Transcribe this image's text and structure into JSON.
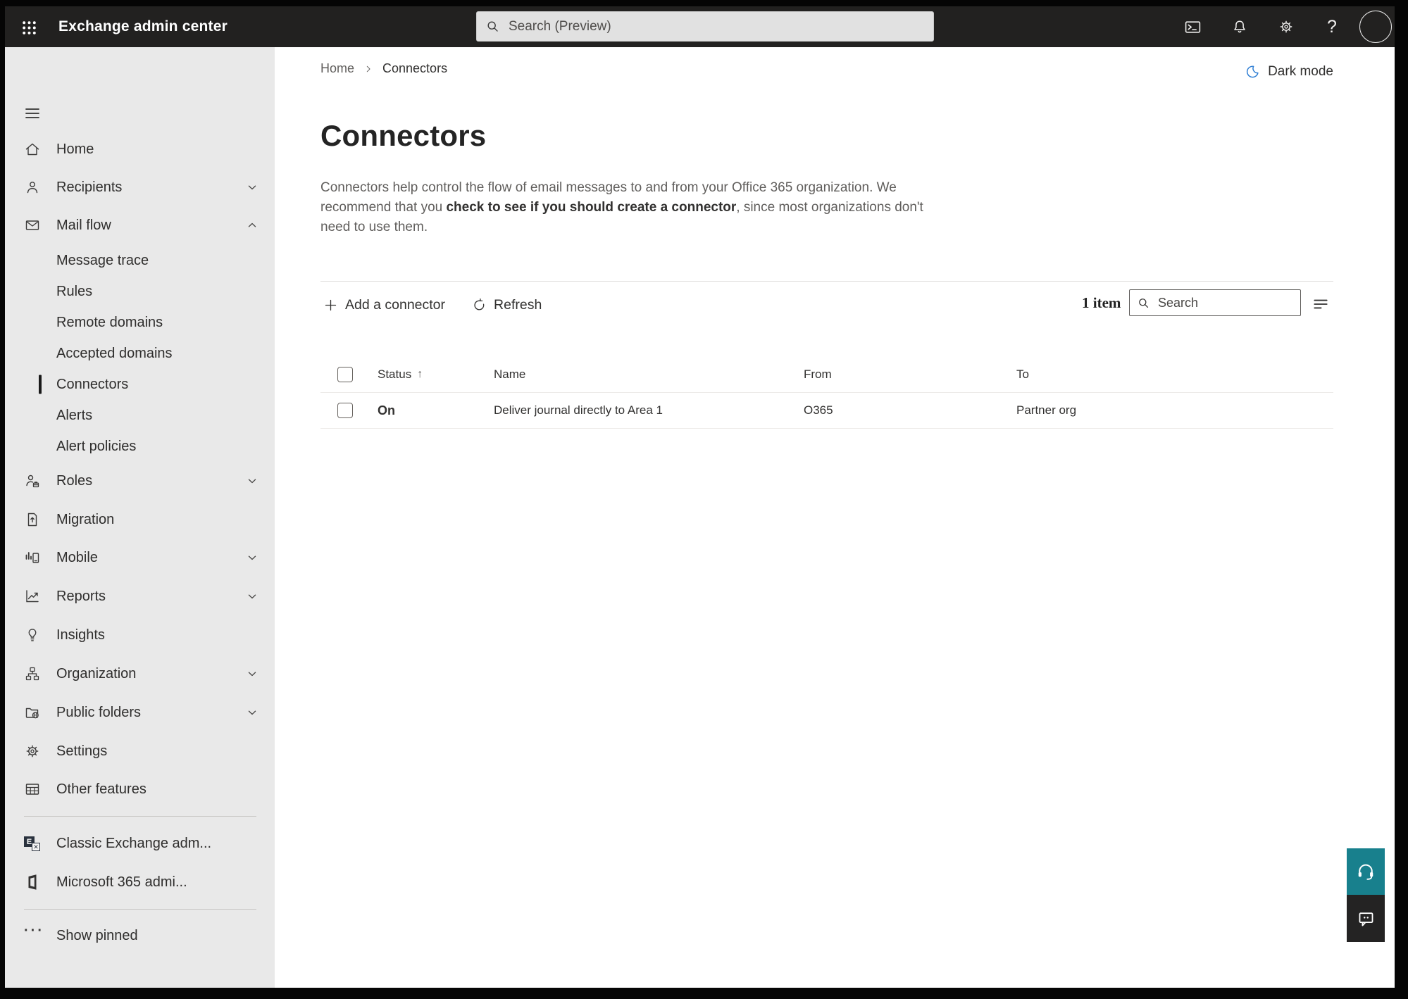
{
  "topbar": {
    "title": "Exchange admin center",
    "search_placeholder": "Search (Preview)",
    "icons": [
      "app-launcher-icon",
      "powershell-icon",
      "notifications-bell-icon",
      "settings-gear-icon",
      "help-icon",
      "avatar"
    ]
  },
  "breadcrumb": {
    "home": "Home",
    "current": "Connectors"
  },
  "theme_toggle": {
    "label": "Dark mode",
    "icon": "moon-icon"
  },
  "page": {
    "title": "Connectors",
    "desc_before": "Connectors help control the flow of email messages to and from your Office 365 organization. We recommend that you ",
    "desc_emphasis": "check to see if you should create a connector",
    "desc_after": ", since most organizations don't need to use them."
  },
  "toolbar": {
    "add": "Add a connector",
    "refresh": "Refresh",
    "count": "1 item",
    "search_placeholder": "Search",
    "icons": [
      "plus-icon",
      "refresh-icon",
      "search-icon",
      "sort-lines-icon"
    ]
  },
  "table": {
    "headers": {
      "status": "Status",
      "sort_arrow": "↑",
      "name": "Name",
      "from": "From",
      "to": "To"
    },
    "rows": [
      {
        "status": "On",
        "name": "Deliver journal directly to Area 1",
        "from": "O365",
        "to": "Partner org"
      }
    ]
  },
  "sidebar": {
    "items": [
      {
        "label": "Home",
        "icon": "home-icon"
      },
      {
        "label": "Recipients",
        "icon": "person-icon",
        "chevron": "down"
      },
      {
        "label": "Mail flow",
        "icon": "mail-icon",
        "chevron": "up",
        "expanded": true
      },
      {
        "label": "Message trace",
        "sub": true
      },
      {
        "label": "Rules",
        "sub": true
      },
      {
        "label": "Remote domains",
        "sub": true
      },
      {
        "label": "Accepted domains",
        "sub": true
      },
      {
        "label": "Connectors",
        "sub": true,
        "selected": true
      },
      {
        "label": "Alerts",
        "sub": true
      },
      {
        "label": "Alert policies",
        "sub": true
      },
      {
        "label": "Roles",
        "icon": "roles-icon",
        "chevron": "down"
      },
      {
        "label": "Migration",
        "icon": "migration-icon"
      },
      {
        "label": "Mobile",
        "icon": "mobile-icon",
        "chevron": "down"
      },
      {
        "label": "Reports",
        "icon": "reports-icon",
        "chevron": "down"
      },
      {
        "label": "Insights",
        "icon": "lightbulb-icon"
      },
      {
        "label": "Organization",
        "icon": "org-chart-icon",
        "chevron": "down"
      },
      {
        "label": "Public folders",
        "icon": "folder-globe-icon",
        "chevron": "down"
      },
      {
        "label": "Settings",
        "icon": "gear-icon"
      },
      {
        "label": "Other features",
        "icon": "grid-table-icon"
      },
      {
        "label": "Classic Exchange adm...",
        "icon": "exchange-logo"
      },
      {
        "label": "Microsoft 365 admi...",
        "icon": "m365-logo"
      },
      {
        "label": "Show pinned",
        "icon": "ellipsis-icon"
      }
    ]
  },
  "fabs": {
    "support_icon": "headset-icon",
    "feedback_icon": "feedback-chat-icon"
  },
  "colors": {
    "topbar_bg": "#222120",
    "sidebar_bg": "#e9e9e9",
    "accent_teal": "#18808d",
    "feedback_dark": "#242323",
    "moon_blue": "#2b7cd3",
    "selected_indicator": "#1a1a1a",
    "text_dark": "#323130",
    "text_gray": "#605e5c"
  }
}
